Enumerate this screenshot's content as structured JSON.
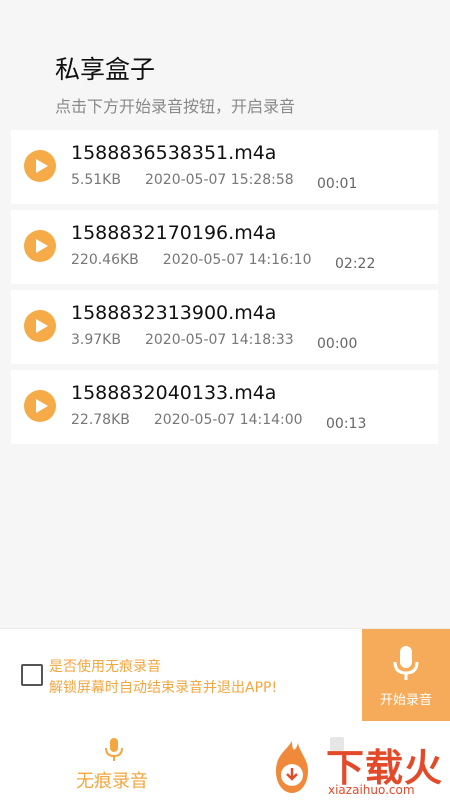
{
  "header": {
    "title": "私享盒子",
    "subtitle": "点击下方开始录音按钮，开启录音"
  },
  "recordings": [
    {
      "name": "1588836538351.m4a",
      "size": "5.51KB",
      "date": "2020-05-07 15:28:58",
      "duration": "00:01"
    },
    {
      "name": "1588832170196.m4a",
      "size": "220.46KB",
      "date": "2020-05-07 14:16:10",
      "duration": "02:22"
    },
    {
      "name": "1588832313900.m4a",
      "size": "3.97KB",
      "date": "2020-05-07 14:18:33",
      "duration": "00:00"
    },
    {
      "name": "1588832040133.m4a",
      "size": "22.78KB",
      "date": "2020-05-07 14:14:00",
      "duration": "00:13"
    }
  ],
  "bottom": {
    "option_line1": "是否使用无痕录音",
    "option_line2": "解锁屏幕时自动结束录音并退出APP!",
    "record_button": "开始录音",
    "nav_label": "无痕录音"
  },
  "watermark": {
    "brand": "下载火",
    "url": "xiazaihuo.com"
  },
  "colors": {
    "accent": "#f5ab48",
    "watermark": "#e24a2a"
  },
  "icons": {
    "play": "play-icon",
    "mic": "microphone-icon",
    "checkbox": "checkbox-icon"
  }
}
